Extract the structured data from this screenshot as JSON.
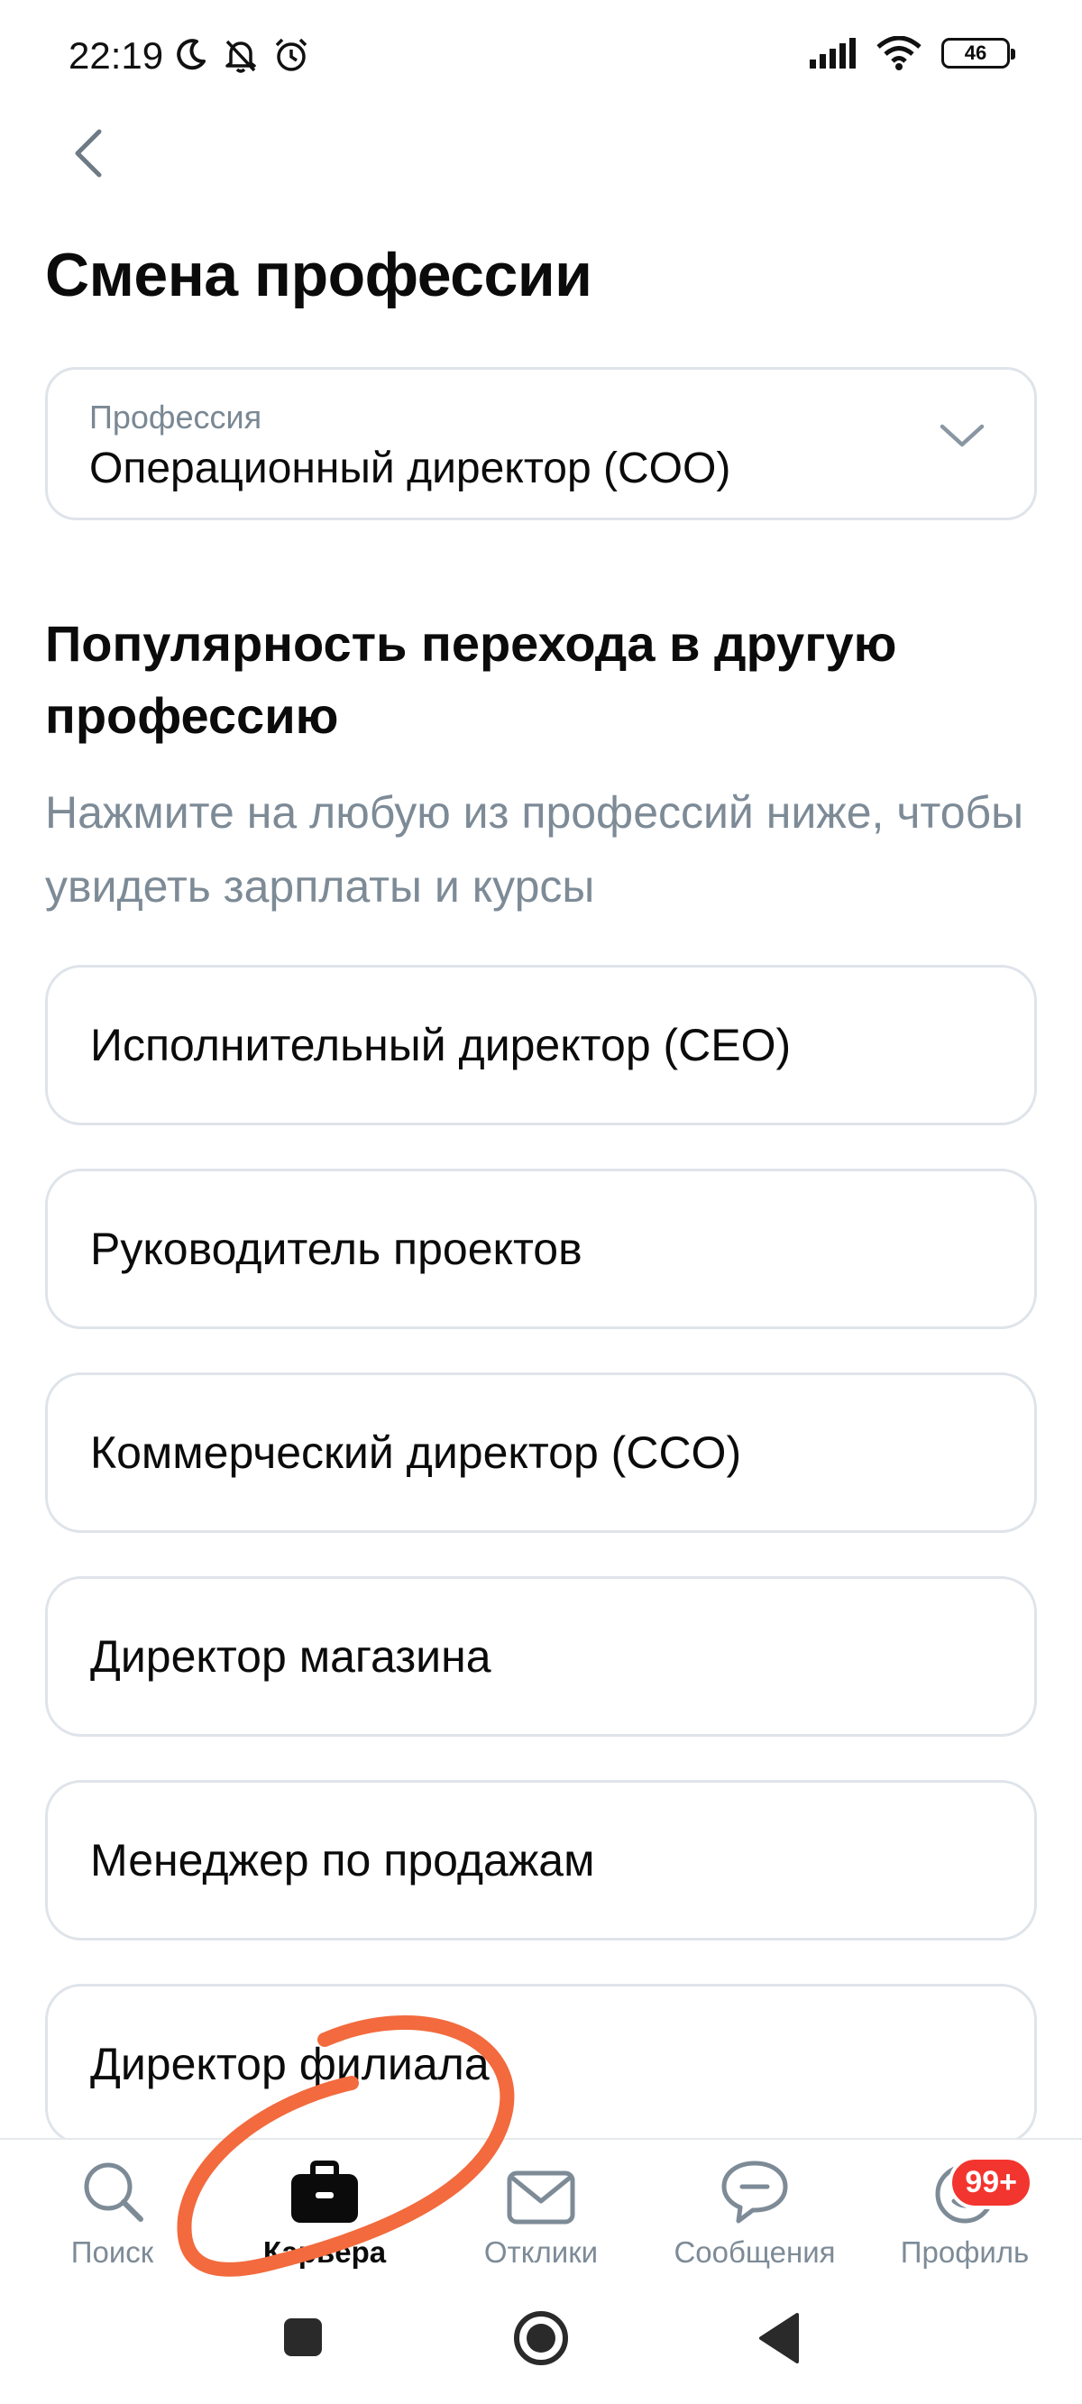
{
  "status_bar": {
    "time": "22:19",
    "battery": "46",
    "icons": [
      "moon-icon",
      "bell-off-icon",
      "alarm-icon",
      "signal-icon",
      "wifi-icon",
      "battery-icon"
    ]
  },
  "header": {
    "title": "Смена профессии",
    "back_icon": "chevron-left-icon"
  },
  "profession_select": {
    "label": "Профессия",
    "value": "Операционный директор (COO)",
    "icon": "chevron-down-icon"
  },
  "section": {
    "title": "Популярность перехода в другую профессию",
    "hint": "Нажмите на любую из профессий ниже, чтобы увидеть зарплаты и курсы"
  },
  "professions": [
    "Исполнительный директор (CEO)",
    "Руководитель проектов",
    "Коммерческий директор (CCO)",
    "Директор магазина",
    "Менеджер по продажам",
    "Директор филиала"
  ],
  "tab_bar": {
    "tabs": [
      {
        "label": "Поиск",
        "icon": "search-icon",
        "active": false
      },
      {
        "label": "Карьера",
        "icon": "briefcase-icon",
        "active": true
      },
      {
        "label": "Отклики",
        "icon": "envelope-icon",
        "active": false
      },
      {
        "label": "Сообщения",
        "icon": "chat-bubble-icon",
        "active": false
      },
      {
        "label": "Профиль",
        "icon": "profile-avatar-icon",
        "active": false
      }
    ],
    "profile_badge": "99+"
  },
  "colors": {
    "text_primary": "#0b0b0b",
    "text_secondary": "#7d8b97",
    "border": "#dfe4ea",
    "badge": "#f3352f",
    "annotation": "#f26a3d"
  }
}
